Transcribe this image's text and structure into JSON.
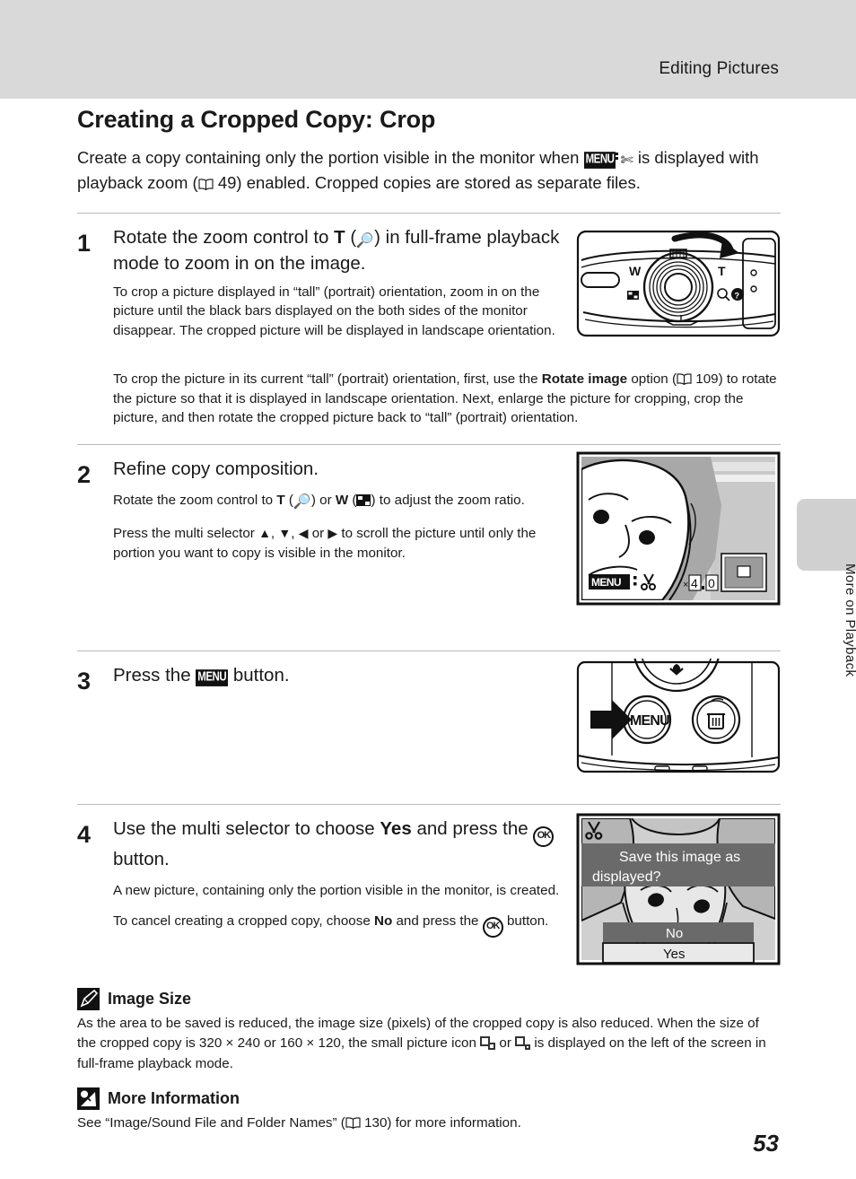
{
  "header": {
    "title": "Editing Pictures"
  },
  "side_tab": {
    "label": "More on Playback"
  },
  "page": {
    "heading": "Creating a Cropped Copy: Crop",
    "number": "53"
  },
  "intro": {
    "part1": "Create a copy containing only the portion visible in the monitor when ",
    "part2": " is displayed with playback zoom (",
    "ref_page": "49",
    "part3": ") enabled. Cropped copies are stored as separate files."
  },
  "steps": [
    {
      "num": "1",
      "title_a": "Rotate the zoom control to ",
      "title_t": "T",
      "title_b": " (",
      "title_c": ") in full-frame playback mode to zoom in on the image.",
      "detail1": "To crop a picture displayed in “tall” (portrait) orientation, zoom in on the picture until the black bars displayed on the both sides of the monitor disappear. The cropped picture will be displayed in landscape orientation.",
      "detail2_a": "To crop the picture in its current “tall” (portrait) orientation, first, use the ",
      "detail2_bold": "Rotate image",
      "detail2_b": " option (",
      "detail2_ref": "109",
      "detail2_c": ") to rotate the picture so that it is displayed in landscape orientation. Next, enlarge the picture for cropping, crop the picture, and then rotate the cropped picture back to “tall” (portrait) orientation.",
      "figure": "camera-top-zoom-control"
    },
    {
      "num": "2",
      "title": "Refine copy composition.",
      "detail1_a": "Rotate the zoom control to ",
      "detail1_t": "T",
      "detail1_b": " (",
      "detail1_c": ") or ",
      "detail1_w": "W",
      "detail1_d": " (",
      "detail1_e": ") to adjust the zoom ratio.",
      "detail2_a": "Press the multi selector ",
      "detail2_b": ", ",
      "detail2_c": ", ",
      "detail2_d": " or ",
      "detail2_e": " to scroll the picture until only the portion you want to copy is visible in the monitor.",
      "figure": "monitor-zoomed-face"
    },
    {
      "num": "3",
      "title_a": "Press the ",
      "title_menu": "MENU",
      "title_b": " button.",
      "figure": "camera-back-menu-button"
    },
    {
      "num": "4",
      "title_a": "Use the multi selector to choose ",
      "title_bold": "Yes",
      "title_b": " and press the ",
      "title_c": " button.",
      "detail1": "A new picture, containing only the portion visible in the monitor, is created.",
      "detail2_a": "To cancel creating a cropped copy, choose ",
      "detail2_bold": "No",
      "detail2_b": " and press the ",
      "detail2_c": " button.",
      "figure": "monitor-save-dialog"
    }
  ],
  "figures": {
    "camera_zoom": {
      "label_w": "W",
      "label_t": "T",
      "help_mark": "?"
    },
    "monitor_zoom": {
      "zoom_ratio": "4.0",
      "zoom_prefix": "×"
    },
    "camera_menu": {
      "menu_label": "MENU"
    },
    "save_dialog": {
      "message_line1": "Save this image as",
      "message_line2": "displayed?",
      "option_no": "No",
      "option_yes": "Yes"
    }
  },
  "notes": [
    {
      "icon": "pencil-note-icon",
      "title": "Image Size",
      "body_a": "As the area to be saved is reduced, the image size (pixels) of the cropped copy is also reduced. When the size of the cropped copy is 320 × 240 or 160 × 120, the small picture icon ",
      "body_b": " or ",
      "body_c": " is displayed on the left of the screen in full-frame playback mode."
    },
    {
      "icon": "magnifier-note-icon",
      "title": "More Information",
      "body_a": "See “Image/Sound File and Folder Names” (",
      "body_ref": "130",
      "body_b": ") for more information."
    }
  ],
  "colors": {
    "header_band": "#d9d9d9",
    "side_tab": "#d0d0d0",
    "rule": "#b9b9b9",
    "text": "#1a1a1a"
  }
}
